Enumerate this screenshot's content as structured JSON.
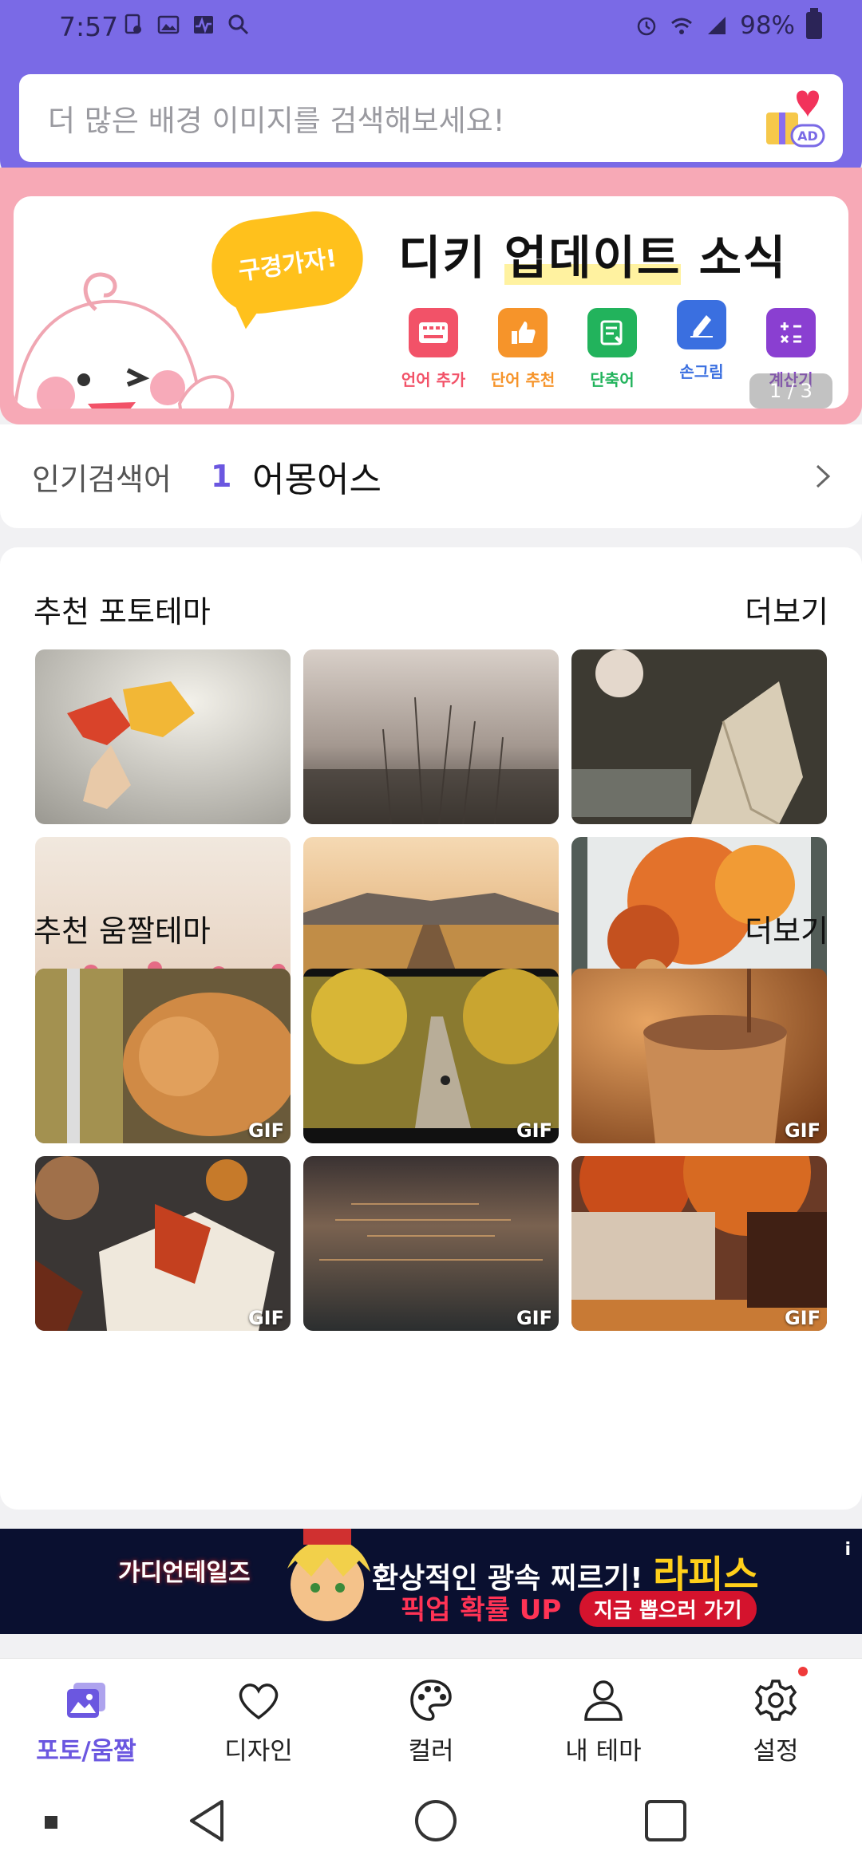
{
  "status_bar": {
    "time": "7:57",
    "battery": "98%"
  },
  "search": {
    "placeholder": "더 많은 배경 이미지를 검색해보세요!",
    "ad_badge": "AD"
  },
  "banner": {
    "bubble_text": "구경가자!",
    "title_pre": "디키 ",
    "title_hl": "업데이트",
    "title_post": " 소식",
    "features": [
      {
        "label": "언어 추가",
        "color": "#f25268",
        "icon": "keyboard-icon"
      },
      {
        "label": "단어 추천",
        "color": "#f6942a",
        "icon": "thumbs-up-icon"
      },
      {
        "label": "단축어",
        "color": "#22b35c",
        "icon": "note-icon"
      },
      {
        "label": "손그림",
        "color": "#3a6fe0",
        "icon": "pen-icon"
      },
      {
        "label": "계산기",
        "color": "#8a3fd1",
        "icon": "calculator-icon"
      }
    ],
    "pager": "1 / 3"
  },
  "trending": {
    "label": "인기검색어",
    "rank": "1",
    "keyword": "어몽어스"
  },
  "photo_section": {
    "title": "추천 포토테마",
    "more": "더보기"
  },
  "gif_section": {
    "title": "추천 움짤테마",
    "more": "더보기",
    "gif_badge": "GIF"
  },
  "ad": {
    "game_title": "가디언테일즈",
    "headline": "환상적인 광속 찌르기!",
    "headline_name": "라피스",
    "sub": "픽업 확률 UP",
    "cta": "지금 뽑으러 가기",
    "info": "i"
  },
  "bottom_nav": {
    "items": [
      {
        "label": "포토/움짤",
        "icon": "gallery-icon",
        "active": true
      },
      {
        "label": "디자인",
        "icon": "heart-icon"
      },
      {
        "label": "컬러",
        "icon": "palette-icon"
      },
      {
        "label": "내 테마",
        "icon": "person-icon"
      },
      {
        "label": "설정",
        "icon": "gear-icon"
      }
    ]
  },
  "colors": {
    "header": "#7a6ae6",
    "accent": "#6b57e0",
    "banner_bg": "#f7a9b6"
  }
}
